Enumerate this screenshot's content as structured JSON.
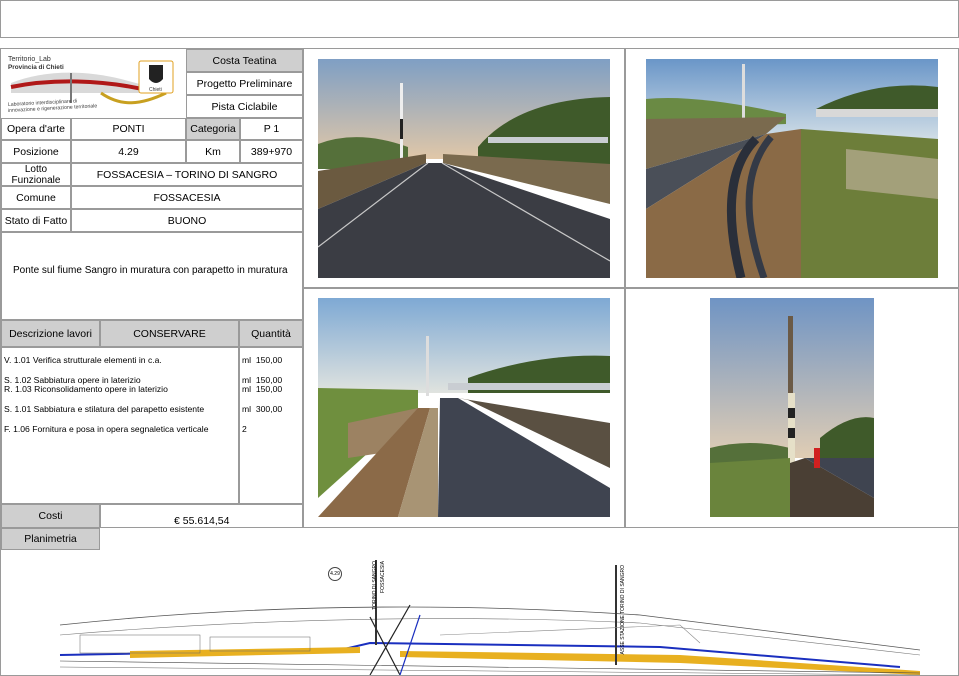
{
  "header": {
    "logo": {
      "line1": "Territorio_Lab",
      "line2": "Provincia di Chieti",
      "line3": "Laboratorio interdisciplinare di",
      "line4": "innovazione e rigenerazione territoriale",
      "seal_text": "Chieti"
    },
    "titles": [
      "Costa Teatina",
      "Progetto Preliminare",
      "Pista Ciclabile"
    ]
  },
  "fields": {
    "opera_label": "Opera d'arte",
    "opera_value": "PONTI",
    "categoria_label": "Categoria",
    "categoria_value": "P 1",
    "posizione_label": "Posizione",
    "posizione_value": "4.29",
    "km_label": "Km",
    "km_value": "389+970",
    "lotto_label": "Lotto Funzionale",
    "lotto_value": "FOSSACESIA – TORINO DI SANGRO",
    "comune_label": "Comune",
    "comune_value": "FOSSACESIA",
    "stato_label": "Stato di Fatto",
    "stato_value": "BUONO"
  },
  "description": "Ponte sul fiume Sangro in muratura con parapetto in muratura",
  "works": {
    "col_desc": "Descrizione lavori",
    "col_action": "CONSERVARE",
    "col_qty": "Quantità",
    "items": [
      {
        "code": "V. 1.01",
        "text": "Verifica strutturale elementi in c.a.",
        "unit": "ml",
        "qty": "150,00"
      },
      {
        "code": "S. 1.02",
        "text": "Sabbiatura opere in laterizio",
        "unit": "ml",
        "qty": "150,00"
      },
      {
        "code": "R. 1.03",
        "text": "Riconsolidamento opere in laterizio",
        "unit": "ml",
        "qty": "150,00"
      },
      {
        "code": "S. 1.01",
        "text": "Sabbiatura e stilatura del parapetto esistente",
        "unit": "ml",
        "qty": "300,00"
      },
      {
        "code": "F. 1.06",
        "text": "Fornitura e posa in opera segnaletica verticale",
        "unit": "",
        "qty": "2"
      }
    ]
  },
  "costs": {
    "label": "Costi",
    "value": "€ 55.614,54"
  },
  "planimetria": {
    "label": "Planimetria",
    "marker": "4.29",
    "vertical_labels": [
      "TORINO DI SANGRO",
      "FOSSACESIA",
      "ASSE STAZIONE TORINO DI SANGRO"
    ]
  },
  "colors": {
    "header_gray": "#cfcfcf",
    "border": "#9a9a9a",
    "plan_yellow": "#e8b020",
    "plan_blue": "#1a2fbf"
  },
  "photos": [
    "road-bridge-photo",
    "bridge-side-cables-photo",
    "bridge-parapet-photo",
    "signal-pole-photo"
  ]
}
